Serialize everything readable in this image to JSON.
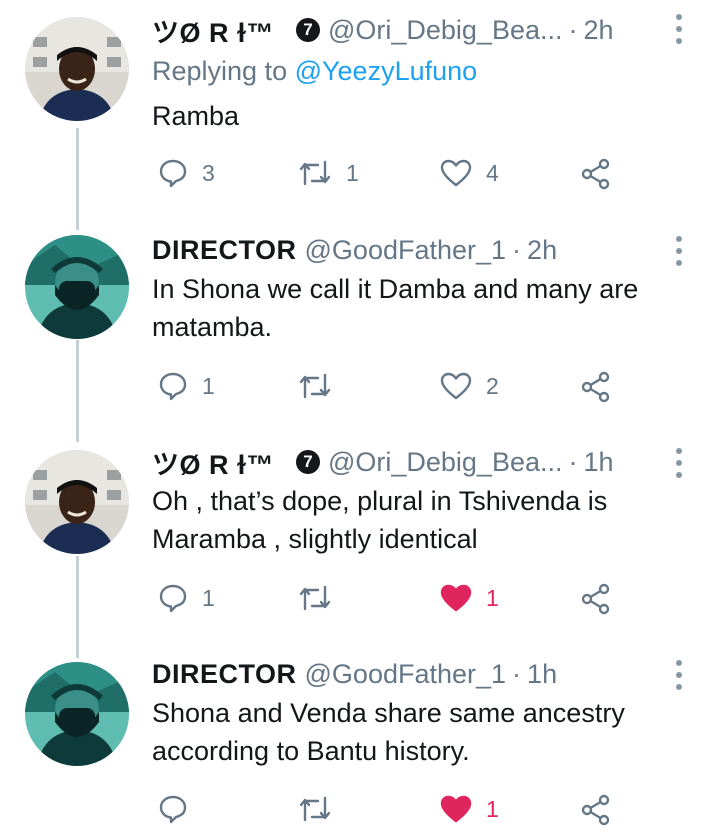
{
  "tweets": [
    {
      "display_name": "ツØ R ɫ™",
      "verified_badge": "7",
      "handle": "@Ori_Debig_Bea...",
      "separator": "·",
      "time": "2h",
      "replying_prefix": "Replying to ",
      "replying_to": "@YeezyLufuno",
      "text": "Ramba",
      "replies": "3",
      "retweets": "1",
      "likes": "4",
      "liked": false,
      "avatar": "person-dark-hoodie-photo"
    },
    {
      "display_name": "DIRECTOR",
      "handle": "@GoodFather_1",
      "separator": "·",
      "time": "2h",
      "text": "In Shona we call it Damba and many are matamba.",
      "replies": "1",
      "retweets": "",
      "likes": "2",
      "liked": false,
      "avatar": "teal-masked-figure-photo"
    },
    {
      "display_name": "ツØ R ɫ™",
      "verified_badge": "7",
      "handle": "@Ori_Debig_Bea...",
      "separator": "·",
      "time": "1h",
      "text": "Oh , that’s dope, plural in Tshivenda is Maramba , slightly identical",
      "replies": "1",
      "retweets": "",
      "likes": "1",
      "liked": true,
      "avatar": "person-dark-hoodie-photo"
    },
    {
      "display_name": "DIRECTOR",
      "handle": "@GoodFather_1",
      "separator": "·",
      "time": "1h",
      "text": "Shona and Venda share same ancestry according to Bantu history.",
      "replies": "",
      "retweets": "",
      "likes": "1",
      "liked": true,
      "avatar": "teal-masked-figure-photo"
    }
  ],
  "icons": {
    "reply": "reply-icon",
    "retweet": "retweet-icon",
    "like": "heart-icon",
    "share": "share-icon",
    "more": "more-vertical-icon"
  },
  "colors": {
    "like_active": "#e0245e",
    "link": "#1da1f2",
    "muted": "#657786",
    "thread_line": "#c4cfd6"
  }
}
